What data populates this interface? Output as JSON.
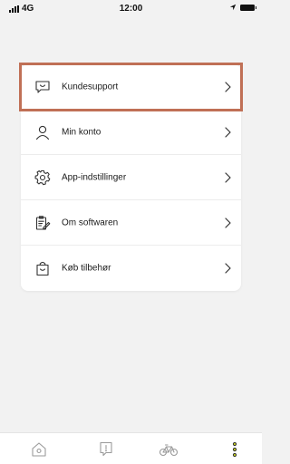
{
  "status_bar": {
    "carrier": "4G",
    "time": "12:00"
  },
  "menu": {
    "items": [
      {
        "label": "Kundesupport",
        "icon": "chat-bubble-smile-icon",
        "highlighted": true
      },
      {
        "label": "Min konto",
        "icon": "person-icon",
        "highlighted": false
      },
      {
        "label": "App-indstillinger",
        "icon": "gear-icon",
        "highlighted": false
      },
      {
        "label": "Om softwaren",
        "icon": "document-edit-icon",
        "highlighted": false
      },
      {
        "label": "Køb tilbehør",
        "icon": "shopping-bag-icon",
        "highlighted": false
      }
    ]
  },
  "tab_bar": {
    "tabs": [
      {
        "icon": "home-icon",
        "active": false
      },
      {
        "icon": "alert-icon",
        "active": false
      },
      {
        "icon": "bicycle-icon",
        "active": false
      },
      {
        "icon": "more-dots-icon",
        "active": true
      }
    ]
  },
  "colors": {
    "background": "#f2f2f2",
    "highlight_border": "#c07056",
    "icon_gray": "#9a9a9a",
    "active_tab": "#c2cc1e"
  }
}
